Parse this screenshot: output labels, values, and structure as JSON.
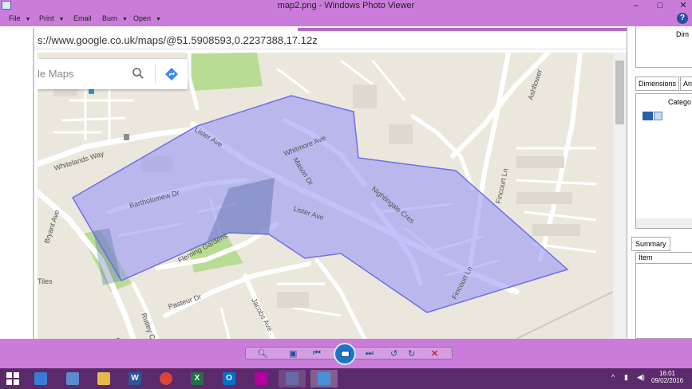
{
  "window": {
    "title": "map2.png - Windows Photo Viewer",
    "minimize": "–",
    "maximize": "□",
    "close": "✕"
  },
  "menu": {
    "items": [
      "File",
      "Print",
      "Email",
      "Burn",
      "Open"
    ],
    "help": "?"
  },
  "browser": {
    "url": "s://www.google.co.uk/maps/@51.5908593,0.2237388,17.12z"
  },
  "map": {
    "search_placeholder": "le Maps",
    "labels": {
      "whitelands_way": "Whitelands Way",
      "bryant_ave": "Bryant Ave",
      "lister_ave_1": "Lister Ave",
      "lister_ave_2": "Lister Ave",
      "whitmore_ave": "Whitmore Ave",
      "mason_dr": "Mason Dr",
      "bartholomew_dr": "Bartholomew Dr",
      "fleming_gardens": "Fleming Gardens",
      "nightingale_cres": "Nightingale Cres",
      "pasteur_dr": "Pasteur Dr",
      "jacobs_ave": "Jacobs Ave",
      "rutley_cl": "Rutley Cl",
      "ashflower": "Ashflower",
      "fincourt_ln_1": "Fincourt Ln",
      "fincourt_ln_2": "Fincourt Ln",
      "tiles": "Tiles",
      "br": "Br"
    },
    "colors": {
      "background": "#ebe7dd",
      "road": "#ffffff",
      "park": "#b9dc94",
      "polygon_fill": "#8f8ff5",
      "polygon_stroke": "#7070e8"
    }
  },
  "right_panel": {
    "col_header": "Dim",
    "tab_dimensions": "Dimensions",
    "tab_other": "Ann",
    "category_header": "Catego",
    "summary_tab": "Summary",
    "item_header": "Item"
  },
  "taskbar": {
    "time": "16:01",
    "date": "09/02/2016",
    "apps": [
      "File Explorer",
      "Word",
      "Chrome",
      "Excel",
      "Outlook",
      "App",
      "App",
      "Photo Viewer"
    ]
  }
}
